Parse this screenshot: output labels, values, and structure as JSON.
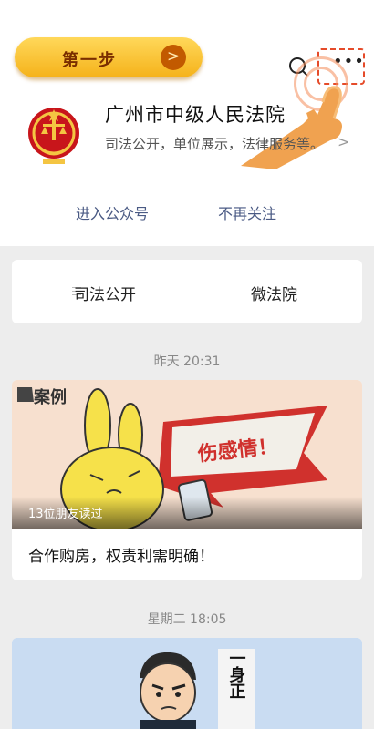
{
  "tutorial": {
    "step_label": "第一步",
    "arrow_glyph": ">"
  },
  "account": {
    "name": "广州市中级人民法院",
    "description": "司法公开，单位展示，法律服务等。",
    "more_glyph": "•••",
    "chevron_glyph": ">"
  },
  "actions": {
    "enter_label": "进入公众号",
    "unfollow_label": "不再关注"
  },
  "menu": {
    "tabs": [
      {
        "label": "司法公开"
      },
      {
        "label": "微法院"
      }
    ]
  },
  "articles": [
    {
      "timestamp": "昨天 20:31",
      "read_count": "13位朋友读过",
      "headline": "合作购房，权责利需明确！",
      "thumb_tag": "案例",
      "thumb_banner": "伤感情！"
    },
    {
      "timestamp": "星期二 18:05",
      "thumb_text": "一身正"
    }
  ],
  "colors": {
    "accent_link": "#4a5a84",
    "tutorial_pill": "#f5b21a",
    "highlight_box": "#e54b2a"
  }
}
